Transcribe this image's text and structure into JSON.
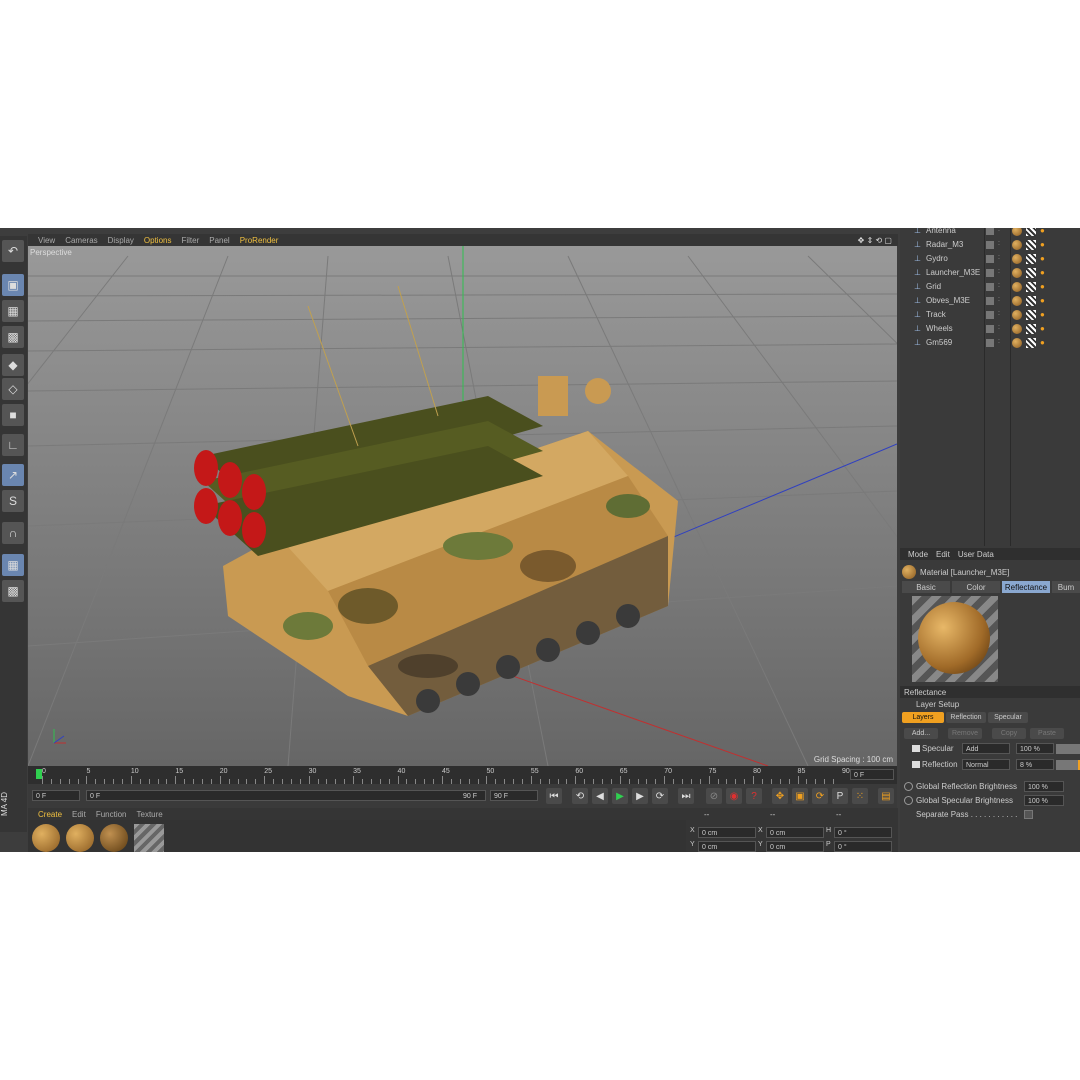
{
  "app": {
    "vertical_label": "MA 4D"
  },
  "viewport_menu": {
    "items": [
      {
        "label": "View",
        "highlight": false
      },
      {
        "label": "Cameras",
        "highlight": false
      },
      {
        "label": "Display",
        "highlight": false
      },
      {
        "label": "Options",
        "highlight": true
      },
      {
        "label": "Filter",
        "highlight": false
      },
      {
        "label": "Panel",
        "highlight": false
      },
      {
        "label": "ProRender",
        "highlight": true
      }
    ]
  },
  "viewport": {
    "camera_label": "Perspective",
    "grid_spacing": "Grid Spacing : 100 cm"
  },
  "timeline": {
    "ticks": [
      "0",
      "5",
      "10",
      "15",
      "20",
      "25",
      "30",
      "35",
      "40",
      "45",
      "50",
      "55",
      "60",
      "65",
      "70",
      "75",
      "80",
      "85",
      "90"
    ],
    "current_frame": "0 F"
  },
  "playback": {
    "start_field": "0 F",
    "range_start": "0 F",
    "range_end": "90 F",
    "end_field": "90 F"
  },
  "material_manager": {
    "menu": [
      {
        "label": "Create",
        "highlight": true
      },
      {
        "label": "Edit",
        "highlight": false
      },
      {
        "label": "Function",
        "highlight": false
      },
      {
        "label": "Texture",
        "highlight": false
      }
    ]
  },
  "coordinates": {
    "header_dashes": [
      "--",
      "--",
      "--"
    ],
    "rows": [
      {
        "a": "X",
        "av": "0 cm",
        "b": "X",
        "bv": "0 cm",
        "c": "H",
        "cv": "0 °"
      },
      {
        "a": "Y",
        "av": "0 cm",
        "b": "Y",
        "bv": "0 cm",
        "c": "P",
        "cv": "0 °"
      }
    ]
  },
  "object_manager": {
    "objects": [
      "Antenna",
      "Radar_M3",
      "Gydro",
      "Launcher_M3E",
      "Grid",
      "Obves_M3E",
      "Track",
      "Wheels",
      "Gm569"
    ]
  },
  "attributes": {
    "menu": [
      "Mode",
      "Edit",
      "User Data"
    ],
    "material_name": "Material [Launcher_M3E]",
    "tabs": [
      {
        "label": "Basic",
        "active": false
      },
      {
        "label": "Color",
        "active": false
      },
      {
        "label": "Reflectance",
        "active": true
      },
      {
        "label": "Bum",
        "active": false
      }
    ],
    "section_title": "Reflectance",
    "layer_setup": "Layer Setup",
    "layer_tabs": [
      "Layers",
      "Reflection",
      "Specular"
    ],
    "buttons": [
      "Add...",
      "Remove",
      "Copy",
      "Paste"
    ],
    "layers": [
      {
        "name": "Specular",
        "mode": "Add",
        "value": "100 %"
      },
      {
        "name": "Reflection",
        "mode": "Normal",
        "value": "8 %"
      }
    ],
    "global_reflection": {
      "label": "Global Reflection Brightness",
      "value": "100 %"
    },
    "global_specular": {
      "label": "Global Specular Brightness",
      "value": "100 %"
    },
    "separate_pass": "Separate Pass . . . . . . . . . . ."
  },
  "colors": {
    "highlight": "#f0c040",
    "active_tab": "#8aa8d0",
    "orange": "#f0a020"
  }
}
